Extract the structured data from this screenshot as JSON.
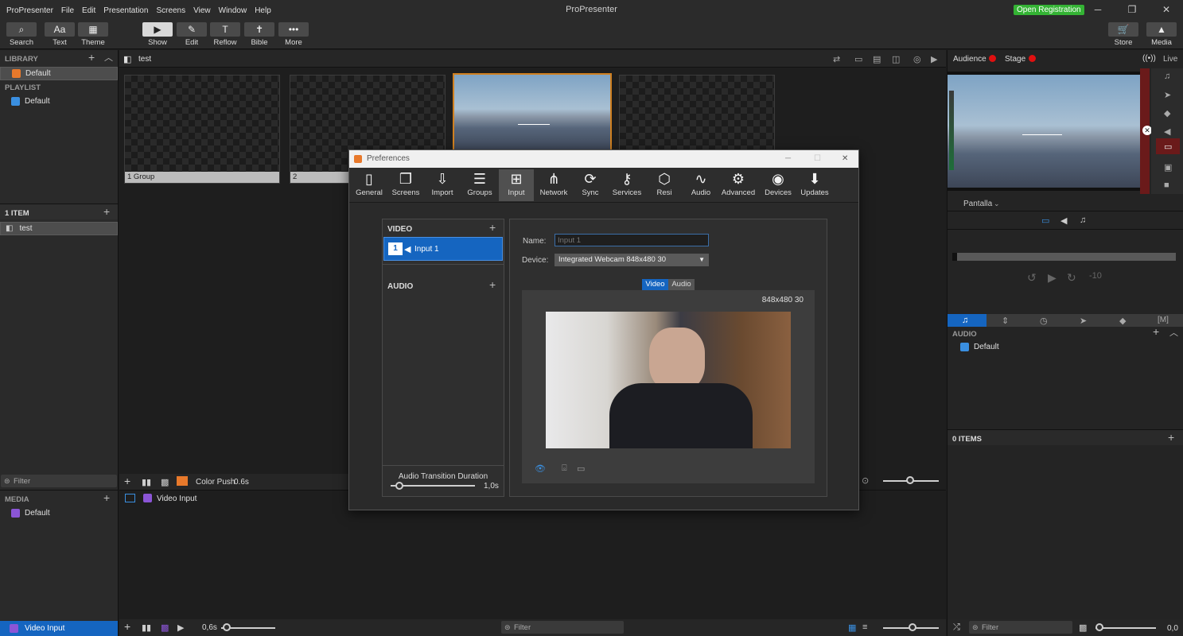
{
  "menubar": {
    "items": [
      "ProPresenter",
      "File",
      "Edit",
      "Presentation",
      "Screens",
      "View",
      "Window",
      "Help"
    ],
    "title": "ProPresenter",
    "open_registration": "Open Registration"
  },
  "toolbar": {
    "left": [
      {
        "label": "Search",
        "icon": "search-icon"
      },
      {
        "label": "Text",
        "icon": "text-icon",
        "glyph": "Aa"
      },
      {
        "label": "Theme",
        "icon": "theme-icon"
      }
    ],
    "center": [
      {
        "label": "Show",
        "icon": "play-icon"
      },
      {
        "label": "Edit",
        "icon": "pencil-icon"
      },
      {
        "label": "Reflow",
        "icon": "reflow-icon"
      },
      {
        "label": "Bible",
        "icon": "bible-icon"
      },
      {
        "label": "More",
        "icon": "more-icon"
      }
    ],
    "right": [
      {
        "label": "Store",
        "icon": "store-icon"
      },
      {
        "label": "Media",
        "icon": "media-icon"
      }
    ]
  },
  "library": {
    "header": "LIBRARY",
    "item": "Default",
    "playlist_header": "PLAYLIST",
    "playlist_item": "Default"
  },
  "items": {
    "header": "1 ITEM",
    "item": "test"
  },
  "left_filter": "Filter",
  "media": {
    "header": "MEDIA",
    "item": "Default",
    "video_input": "Video Input"
  },
  "presentation": {
    "name": "test",
    "slides": [
      {
        "caption": "1  Group"
      },
      {
        "caption": "2"
      },
      {
        "caption": ""
      },
      {
        "caption": ""
      }
    ],
    "transition": "Color Push",
    "transition_time": "0.6s"
  },
  "media_center": {
    "label": "Video Input",
    "time": "0,6s",
    "filter": "Filter"
  },
  "right": {
    "audience": "Audience",
    "stage": "Stage",
    "live": "Live",
    "screen_select": "Pantalla",
    "audio_header": "AUDIO",
    "audio_item": "Default",
    "items_header": "0 ITEMS",
    "filter": "Filter",
    "volume_value": "0,0",
    "accent": "#1565c0",
    "status_red": "#e01010"
  },
  "dialog": {
    "title": "Preferences",
    "tabs": [
      {
        "label": "General",
        "icon": "tablet-icon"
      },
      {
        "label": "Screens",
        "icon": "screens-icon"
      },
      {
        "label": "Import",
        "icon": "import-icon"
      },
      {
        "label": "Groups",
        "icon": "groups-icon"
      },
      {
        "label": "Input",
        "icon": "input-icon"
      },
      {
        "label": "Network",
        "icon": "network-icon"
      },
      {
        "label": "Sync",
        "icon": "sync-icon"
      },
      {
        "label": "Services",
        "icon": "key-icon"
      },
      {
        "label": "Resi",
        "icon": "resi-icon"
      },
      {
        "label": "Audio",
        "icon": "waveform-icon"
      },
      {
        "label": "Advanced",
        "icon": "gear-icon"
      },
      {
        "label": "Devices",
        "icon": "devices-icon"
      },
      {
        "label": "Updates",
        "icon": "download-icon"
      }
    ],
    "video_header": "VIDEO",
    "input_number": "1",
    "input_name": "Input 1",
    "audio_header": "AUDIO",
    "audio_transition_label": "Audio Transition Duration",
    "audio_transition_value": "1,0s",
    "name_label": "Name:",
    "name_placeholder": "Input 1",
    "device_label": "Device:",
    "device_value": "Integrated Webcam 848x480 30",
    "seg_video": "Video",
    "seg_audio": "Audio",
    "resolution": "848x480 30"
  }
}
